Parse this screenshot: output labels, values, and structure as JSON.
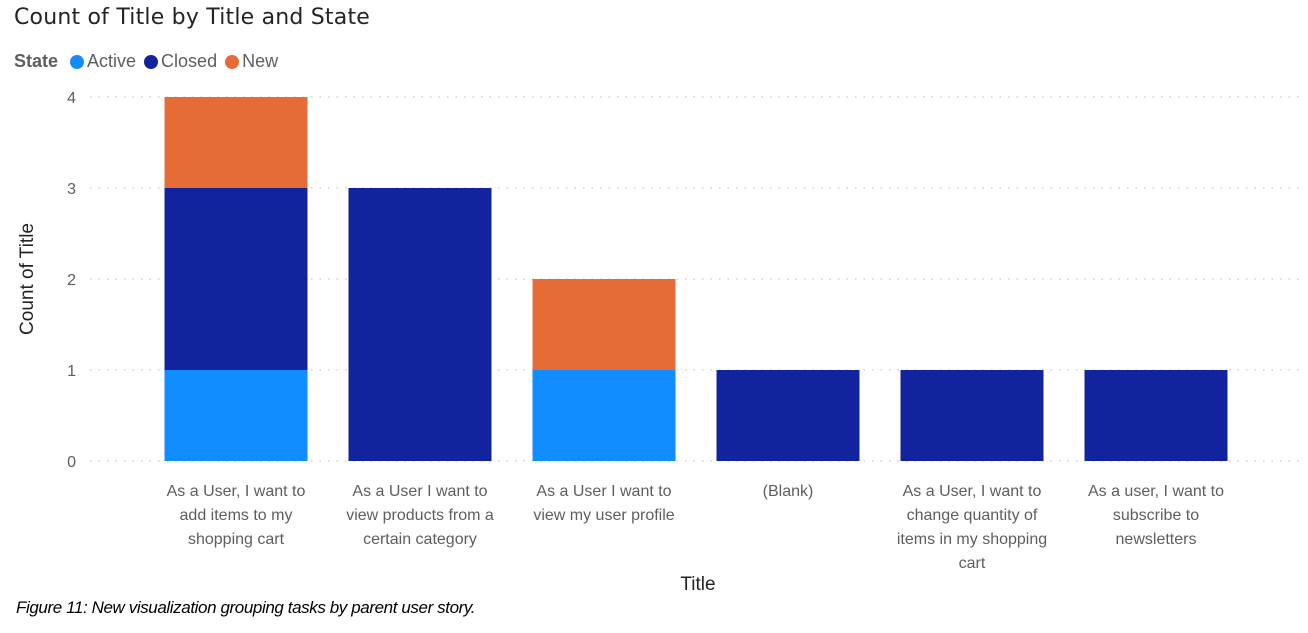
{
  "chart_data": {
    "type": "bar",
    "stacked": true,
    "title": "Count of Title by Title and State",
    "xlabel": "Title",
    "ylabel": "Count of Title",
    "ylim": [
      0,
      4
    ],
    "yticks": [
      "0",
      "1",
      "2",
      "3",
      "4"
    ],
    "grid": true,
    "legend": {
      "title": "State",
      "placement": "top-left"
    },
    "categories": [
      [
        "As a User, I want to",
        "add items to my",
        "shopping cart"
      ],
      [
        "As a User I want to",
        "view products from a",
        "certain category"
      ],
      [
        "As a User I want to",
        "view my user profile"
      ],
      [
        "(Blank)"
      ],
      [
        "As a User, I want to",
        "change quantity of",
        "items in my shopping",
        "cart"
      ],
      [
        "As a user, I want to",
        "subscribe to",
        "newsletters"
      ]
    ],
    "series": [
      {
        "name": "Active",
        "color": "#118DFF",
        "values": [
          1,
          0,
          1,
          0,
          0,
          0
        ]
      },
      {
        "name": "Closed",
        "color": "#12239E",
        "values": [
          2,
          3,
          0,
          1,
          1,
          1
        ]
      },
      {
        "name": "New",
        "color": "#E66C37",
        "values": [
          1,
          0,
          1,
          0,
          0,
          0
        ]
      }
    ]
  },
  "caption": "Figure 11: New visualization grouping tasks by parent user story."
}
